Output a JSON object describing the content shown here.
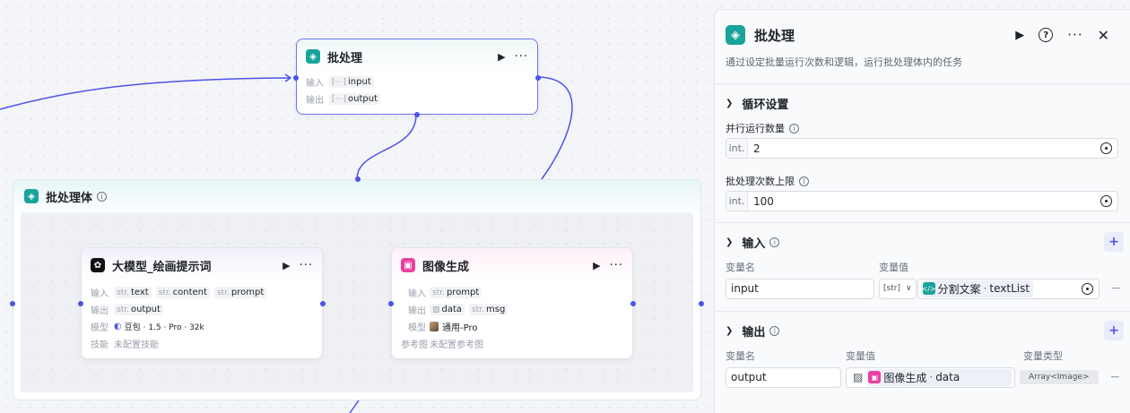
{
  "canvas": {
    "batch_node": {
      "title": "批处理",
      "input_label": "输入",
      "output_label": "输出",
      "input_var": "input",
      "output_var": "output"
    },
    "batch_body": {
      "title": "批处理体"
    },
    "llm_node": {
      "title": "大模型_绘画提示词",
      "input_label": "输入",
      "output_label": "输出",
      "model_label": "模型",
      "skill_label": "技能",
      "type_str": "str.",
      "inputs": [
        "text",
        "content",
        "prompt"
      ],
      "output": "output",
      "model_name": "豆包 · 1.5 · Pro · 32k",
      "skill_value": "未配置技能"
    },
    "image_node": {
      "title": "图像生成",
      "input_label": "输入",
      "output_label": "输出",
      "model_label": "模型",
      "ref_label": "参考图",
      "type_str": "str.",
      "input": "prompt",
      "output_img": "data",
      "output_str": "msg",
      "model_name": "通用-Pro",
      "ref_value": "未配置参考图"
    }
  },
  "panel": {
    "title": "批处理",
    "description": "通过设定批量运行次数和逻辑，运行批处理体内的任务",
    "loop_section": {
      "title": "循环设置",
      "parallel_label": "并行运行数量",
      "parallel_prefix": "int.",
      "parallel_value": "2",
      "limit_label": "批处理次数上限",
      "limit_prefix": "int.",
      "limit_value": "100"
    },
    "input_section": {
      "title": "输入",
      "col_name": "变量名",
      "col_value": "变量值",
      "var_name": "input",
      "var_type": "[str]",
      "ref_node": "分割文案",
      "ref_field": "textList"
    },
    "output_section": {
      "title": "输出",
      "col_name": "变量名",
      "col_value": "变量值",
      "col_type": "变量类型",
      "var_name": "output",
      "ref_node": "图像生成",
      "ref_field": "data",
      "var_type": "Array<Image>"
    }
  },
  "colors": {
    "accent": "#4d53e8",
    "batch_icon": "#1aa39a",
    "image_icon": "#e93fa3"
  }
}
